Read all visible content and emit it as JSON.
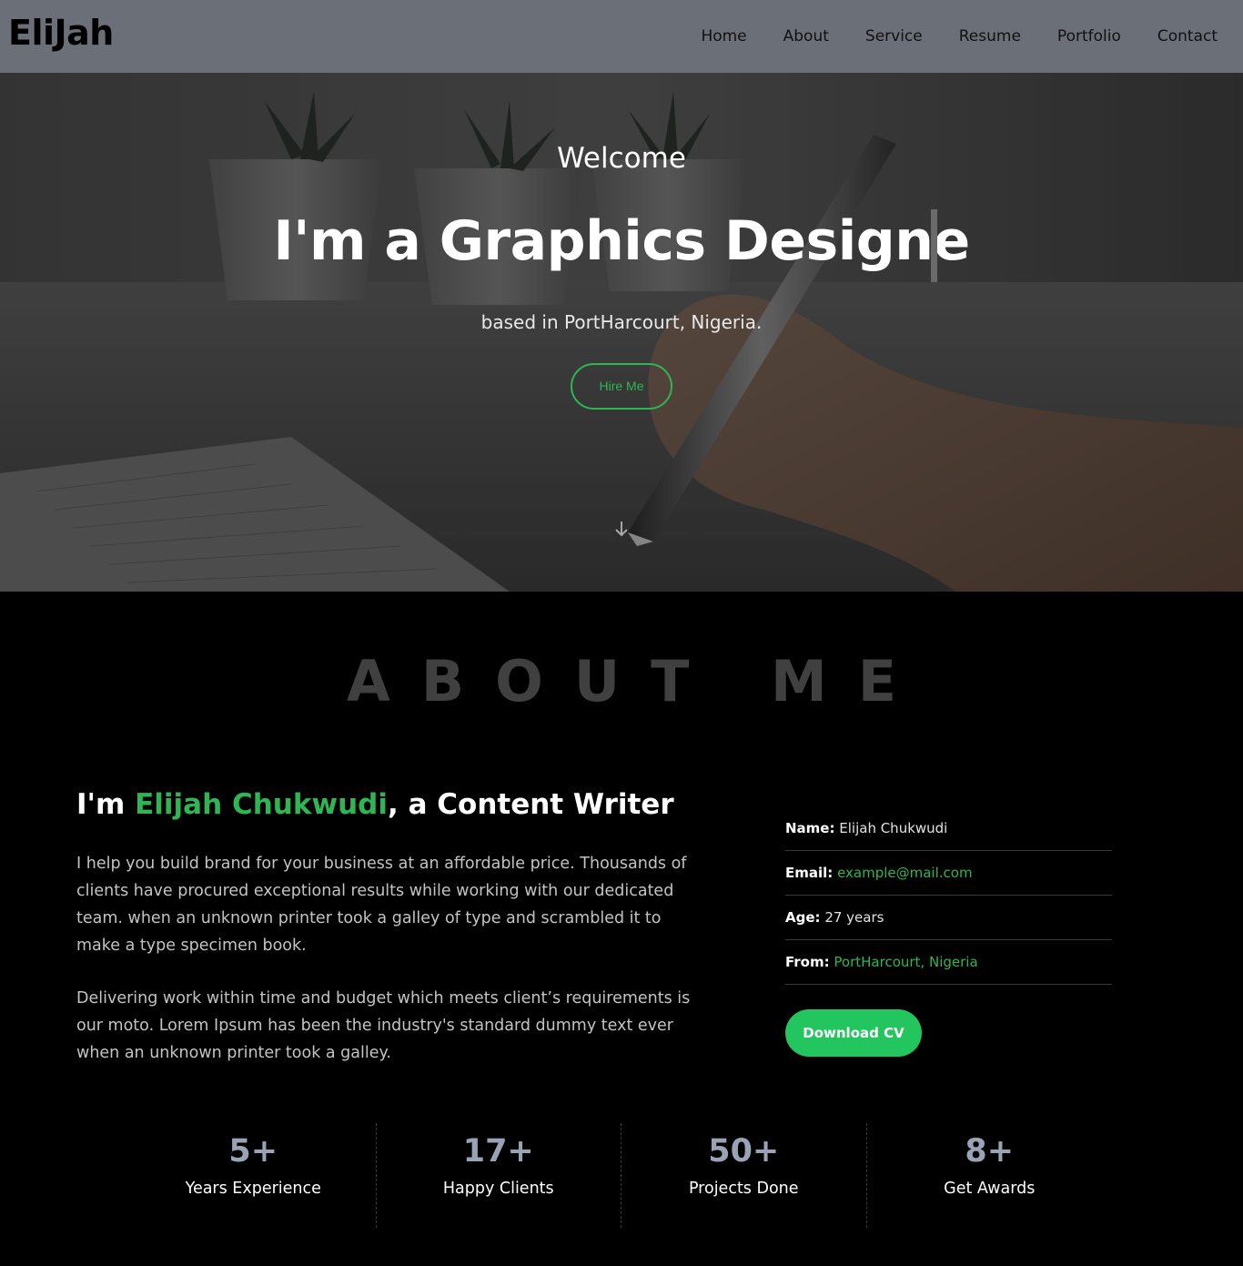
{
  "nav": {
    "brand": "EliJah",
    "links": [
      "Home",
      "About",
      "Service",
      "Resume",
      "Portfolio",
      "Contact"
    ]
  },
  "hero": {
    "welcome": "Welcome",
    "headline": "I'm a Graphics Designe",
    "subtitle": "based in PortHarcourt, Nigeria.",
    "hire_label": "Hire Me",
    "down_icon": "arrow-down-icon"
  },
  "about": {
    "section_title": "ABOUT ME",
    "heading_prefix": "I'm ",
    "heading_name": "Elijah Chukwudi",
    "heading_suffix": ", a Content Writer",
    "paragraph1": "I help you build brand for your business at an affordable price. Thousands of clients have procured exceptional results while working with our dedicated team. when an unknown printer took a galley of type and scrambled it to make a type specimen book.",
    "paragraph2": "Delivering work within time and budget which meets client’s requirements is our moto. Lorem Ipsum has been the industry's standard dummy text ever when an unknown printer took a galley.",
    "info": [
      {
        "label": "Name:",
        "value": "Elijah Chukwudi"
      },
      {
        "label": "Email:",
        "value": "example@mail.com"
      },
      {
        "label": "Age:",
        "value": "27 years"
      },
      {
        "label": "From:",
        "value": "PortHarcourt, Nigeria"
      }
    ],
    "download_label": "Download CV"
  },
  "stats": [
    {
      "number": "5+",
      "label": "Years Experience"
    },
    {
      "number": "17+",
      "label": "Happy Clients"
    },
    {
      "number": "50+",
      "label": "Projects Done"
    },
    {
      "number": "8+",
      "label": "Get Awards"
    }
  ],
  "colors": {
    "accent": "#2fb553",
    "download_bg": "#22c55e",
    "nav_bg": "#6b6f78",
    "stat_number": "#9aa3b5"
  }
}
